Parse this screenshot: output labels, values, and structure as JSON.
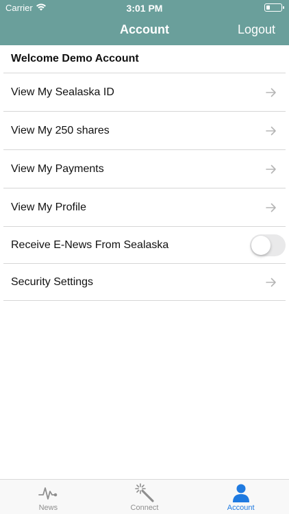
{
  "status": {
    "carrier": "Carrier",
    "time": "3:01 PM"
  },
  "nav": {
    "title": "Account",
    "logout_label": "Logout"
  },
  "welcome_text": "Welcome Demo Account",
  "rows": [
    {
      "label": "View My Sealaska ID"
    },
    {
      "label": "View My 250 shares"
    },
    {
      "label": "View My Payments"
    },
    {
      "label": "View My Profile"
    },
    {
      "label": "Receive E-News From Sealaska",
      "toggle": false
    },
    {
      "label": "Security Settings"
    }
  ],
  "tabs": [
    {
      "label": "News",
      "icon": "pulse-icon",
      "active": false
    },
    {
      "label": "Connect",
      "icon": "magic-wand-icon",
      "active": false
    },
    {
      "label": "Account",
      "icon": "person-icon",
      "active": true
    }
  ],
  "colors": {
    "header": "#6a9f9b",
    "active_tab": "#1f7ae0",
    "inactive_tab": "#8e8e8e"
  }
}
